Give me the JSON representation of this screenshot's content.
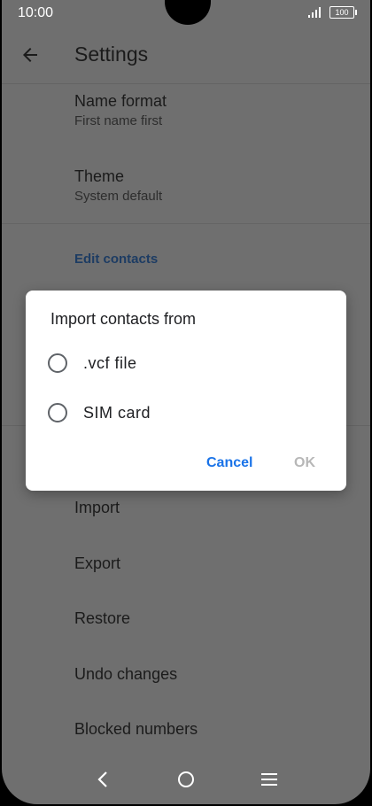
{
  "status_bar": {
    "time": "10:00",
    "battery": "100"
  },
  "app_bar": {
    "title": "Settings"
  },
  "settings": [
    {
      "title": "Name format",
      "subtitle": "First name first"
    },
    {
      "title": "Theme",
      "subtitle": "System default"
    }
  ],
  "section": {
    "edit_contacts": "Edit contacts"
  },
  "list_items": [
    "Import",
    "Export",
    "Restore",
    "Undo changes",
    "Blocked numbers"
  ],
  "dialog": {
    "title": "Import contacts from",
    "options": [
      ".vcf file",
      "SIM card"
    ],
    "cancel": "Cancel",
    "ok": "OK"
  },
  "colors": {
    "accent": "#1a73e8",
    "scrim_bg": "#6f6f6f",
    "disabled": "#b7b7b7"
  },
  "icons": [
    "back-arrow-icon",
    "signal-icon",
    "battery-icon",
    "nav-back-icon",
    "nav-home-icon",
    "nav-menu-icon"
  ]
}
